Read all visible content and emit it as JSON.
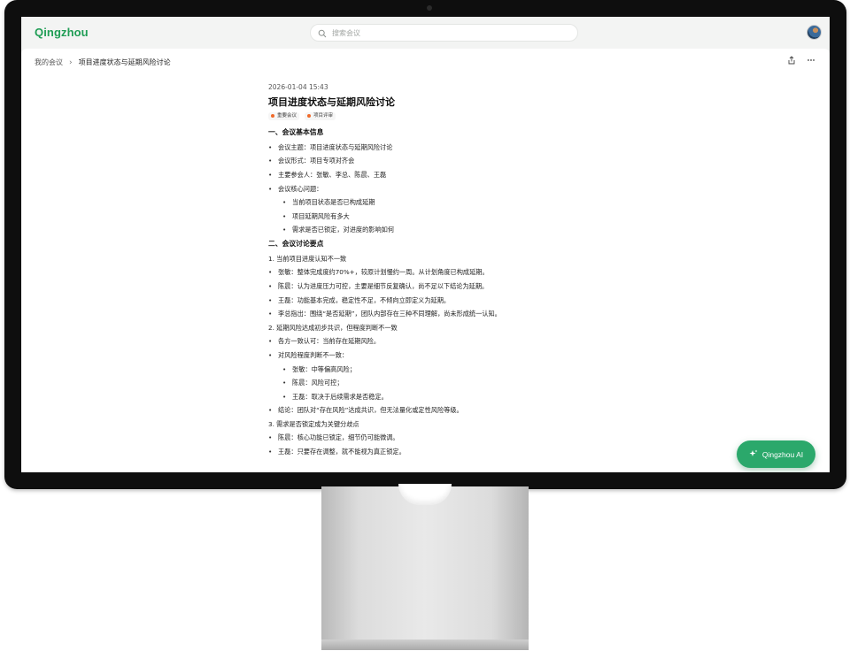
{
  "app": {
    "logo": "Qingzhou",
    "search_placeholder": "搜索会议",
    "ai_button": "Qingzhou AI",
    "brand_color": "#1f9d55",
    "accent_color": "#2ba86b"
  },
  "breadcrumb": {
    "home": "我的会议",
    "current": "项目进度状态与延期风险讨论"
  },
  "icons": {
    "search": "search-icon",
    "share": "share-icon",
    "more": "more-horizontal-icon",
    "sparkle": "sparkle-icon",
    "chevron": "chevron-right-icon"
  },
  "doc": {
    "date": "2026-01-04 15:43",
    "title": "项目进度状态与延期风险讨论",
    "tags": [
      "重要会议",
      "项目评审"
    ],
    "s1_heading": "一、会议基本信息",
    "s1_items": [
      "会议主题：项目进度状态与延期风险讨论",
      "会议形式：项目专项对齐会",
      "主要参会人：张敏、李总、陈晨、王磊",
      "会议核心问题："
    ],
    "s1_sub": [
      "当前项目状态是否已构成延期",
      "项目延期风险有多大",
      "需求是否已锁定，对进度的影响如何"
    ],
    "s2_heading": "二、会议讨论要点",
    "p1": "1. 当前项目进度认知不一致",
    "p1_items": [
      "张敏：整体完成度约70%+，较原计划慢约一周。从计划角度已构成延期。",
      "陈晨：认为进度压力可控，主要是细节反复确认，尚不足以下结论为延期。",
      "王磊：功能基本完成，稳定性不足，不倾向立即定义为延期。",
      "李总指出：围绕“是否延期”，团队内部存在三种不同理解，尚未形成统一认知。"
    ],
    "p2": "2. 延期风险达成初步共识，但程度判断不一致",
    "p2_items": [
      "各方一致认可：当前存在延期风险。",
      "对风险程度判断不一致："
    ],
    "p2_sub": [
      "张敏：中等偏高风险；",
      "陈晨：风险可控；",
      "王磊：取决于后续需求是否稳定。"
    ],
    "p2_conclusion": "结论：团队对“存在风险”达成共识，但无法量化或定性风险等级。",
    "p3": "3. 需求是否锁定成为关键分歧点",
    "p3_items": [
      "陈晨：核心功能已锁定，细节仍可能微调。",
      "王磊：只要存在调整，就不能视为真正锁定。"
    ]
  }
}
